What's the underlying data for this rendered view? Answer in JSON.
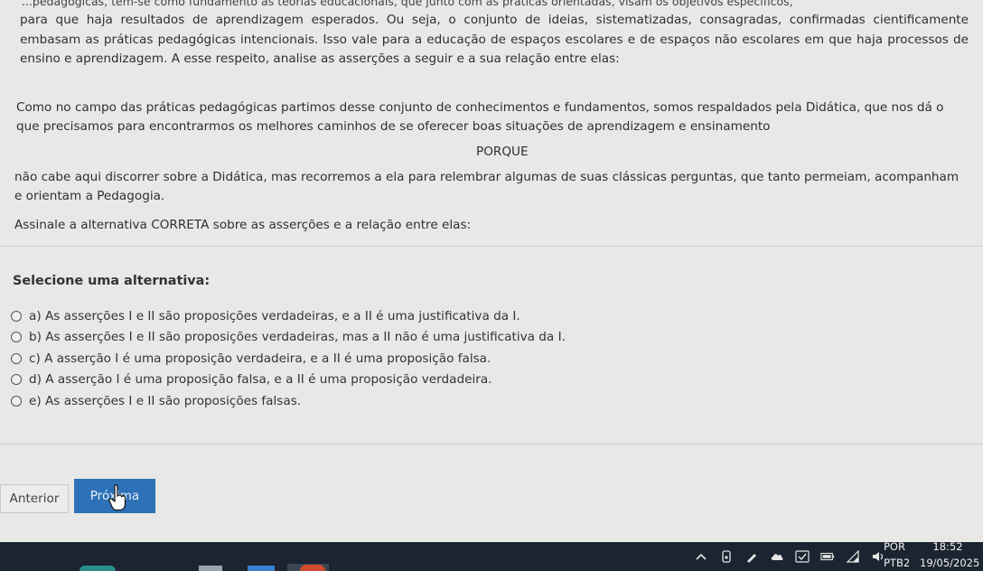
{
  "question": {
    "top_cut_line": "...pedagógicas, tem-se como fundamento as teorias educacionais, que junto com as práticas orientadas, visam os objetivos específicos,",
    "intro": "para que haja resultados de aprendizagem esperados. Ou seja, o conjunto de ideias, sistematizadas, consagradas, confirmadas cientificamente embasam as práticas pedagógicas intencionais. Isso vale para a educação de espaços escolares e de espaços não escolares em que haja processos de ensino e aprendizagem. A esse respeito, analise as asserções a seguir e a sua relação entre elas:",
    "assertion_1": "Como no campo das práticas pedagógicas partimos desse conjunto de conhecimentos e fundamentos, somos respaldados pela Didática, que nos dá o que precisamos para encontrarmos os melhores caminhos de se oferecer boas situações de aprendizagem e ensinamento",
    "connector": "PORQUE",
    "assertion_2": "não cabe aqui discorrer sobre a Didática, mas recorremos a ela para relembrar algumas de suas clássicas perguntas, que tanto permeiam, acompanham e orientam a Pedagogia.",
    "instruction": "Assinale a alternativa CORRETA sobre as asserções e a relação entre elas:"
  },
  "select_title": "Selecione uma alternativa:",
  "options": [
    "a) As asserções I e II são proposições verdadeiras, e a II é uma justificativa da I.",
    "b) As asserções I e II são proposições verdadeiras, mas a II não é uma justificativa da I.",
    "c) A asserção I é uma proposição verdadeira, e a II é uma proposição falsa.",
    "d) A asserção I é uma proposição falsa, e a II é uma proposição verdadeira.",
    "e) As asserções I e II são proposições falsas."
  ],
  "nav": {
    "prev_label": "Anterior",
    "next_label": "Próxima"
  },
  "taskbar": {
    "lang_top": "POR",
    "lang_bottom": "PTB2",
    "time": "18:52",
    "date": "19/05/2025"
  },
  "colors": {
    "next_button": "#2d72b8",
    "taskbar": "#1b2430"
  }
}
